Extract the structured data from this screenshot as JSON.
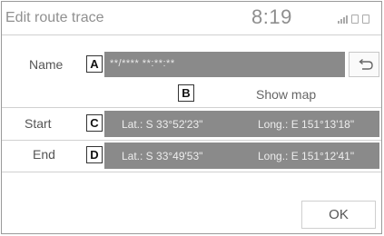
{
  "header": {
    "title": "Edit route trace",
    "time": "8:19",
    "status_icons": [
      "signal-icon",
      "phone-icon",
      "battery-icon"
    ]
  },
  "name_row": {
    "label": "Name",
    "callout": "A",
    "value": "**/**** **:**:**",
    "back_icon": "back-arrow-icon"
  },
  "map_row": {
    "callout": "B",
    "show_map": "Show map"
  },
  "start_row": {
    "label": "Start",
    "callout": "C",
    "lat": "Lat.: S 33°52'23\"",
    "long": "Long.: E 151°13'18\""
  },
  "end_row": {
    "label": "End",
    "callout": "D",
    "lat": "Lat.: S 33°49'53\"",
    "long": "Long.: E 151°12'41\""
  },
  "footer": {
    "ok": "OK"
  },
  "colors": {
    "bar": "#8a8a8a",
    "text_gray": "#909090"
  }
}
